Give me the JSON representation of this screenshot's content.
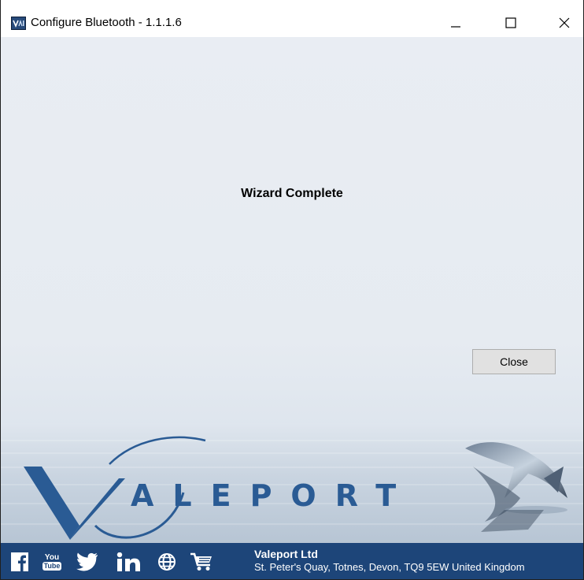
{
  "window": {
    "title": "Configure Bluetooth - 1.1.1.6",
    "controls": [
      "minimize",
      "maximize",
      "close"
    ]
  },
  "wizard": {
    "heading": "Wizard Complete",
    "close_label": "Close"
  },
  "brand": {
    "logo_text": "ALEPORT",
    "logo_initial": "V"
  },
  "footer": {
    "social_icons": [
      "facebook-icon",
      "youtube-icon",
      "twitter-icon",
      "linkedin-icon",
      "globe-icon",
      "cart-icon"
    ],
    "youtube_top": "You",
    "youtube_bottom": "Tube",
    "company": "Valeport Ltd",
    "address": "St. Peter's Quay, Totnes, Devon, TQ9 5EW United Kingdom"
  },
  "colors": {
    "client_bg": "#e9edf3",
    "footer_bg": "#1d4579",
    "logo_blue": "#2a5b94",
    "button_bg": "#e1e1e1"
  }
}
